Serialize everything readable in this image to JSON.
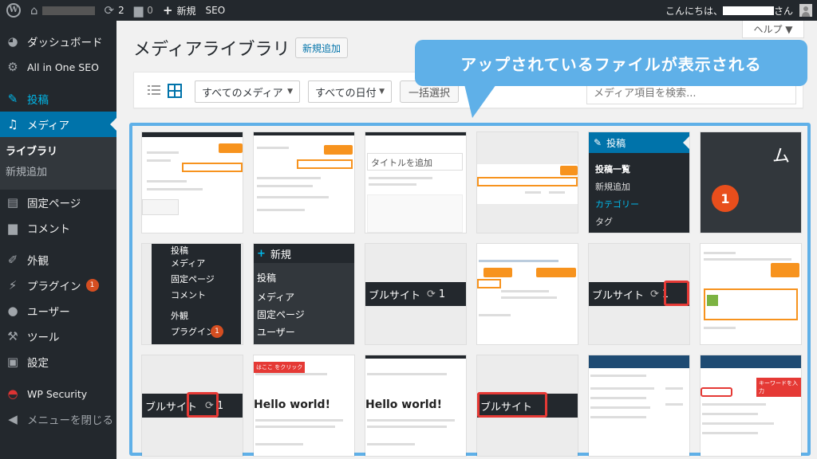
{
  "admin_bar": {
    "updates_count": "2",
    "comments_count": "0",
    "new_label": "新規",
    "seo_label": "SEO",
    "greeting_prefix": "こんにちは、",
    "greeting_suffix": "さん"
  },
  "sidebar": {
    "items": [
      {
        "label": "ダッシュボード",
        "icon": "dashboard-icon"
      },
      {
        "label": "All in One SEO",
        "icon": "gear-icon"
      },
      {
        "label": "投稿",
        "icon": "pin-icon"
      },
      {
        "label": "メディア",
        "icon": "media-icon"
      },
      {
        "label": "固定ページ",
        "icon": "page-icon"
      },
      {
        "label": "コメント",
        "icon": "comment-icon"
      },
      {
        "label": "外観",
        "icon": "brush-icon"
      },
      {
        "label": "プラグイン",
        "icon": "plugin-icon",
        "badge": "1"
      },
      {
        "label": "ユーザー",
        "icon": "user-icon"
      },
      {
        "label": "ツール",
        "icon": "wrench-icon"
      },
      {
        "label": "設定",
        "icon": "settings-icon"
      },
      {
        "label": "WP Security",
        "icon": "shield-icon"
      },
      {
        "label": "メニューを閉じる",
        "icon": "collapse-icon"
      }
    ],
    "submenu": [
      "ライブラリ",
      "新規追加"
    ]
  },
  "header": {
    "help_label": "ヘルプ ▼",
    "title": "メディアライブラリ",
    "add_new": "新規追加"
  },
  "toolbar": {
    "media_filter": "すべてのメディア",
    "date_filter": "すべての日付",
    "bulk_select": "一括選択",
    "search_placeholder": "メディア項目を検索..."
  },
  "callout": {
    "text": "アップされているファイルが表示される"
  },
  "tiles": {
    "t5": {
      "pin_label": "投稿",
      "items": [
        "投稿一覧",
        "新規追加",
        "カテゴリー",
        "タグ"
      ]
    },
    "t6": {
      "number": "1"
    },
    "t7": {
      "items": [
        "メディア",
        "固定ページ",
        "コメント",
        "外観",
        "プラグイン"
      ],
      "badge": "1",
      "top": "投稿"
    },
    "t8": {
      "new_label": "新規",
      "items": [
        "投稿",
        "メディア",
        "固定ページ",
        "ユーザー"
      ]
    },
    "t9": {
      "text": "ブルサイト",
      "count": "1"
    },
    "t11": {
      "text": "ブルサイト",
      "count": "1"
    },
    "t13": {
      "text": "ブルサイト",
      "count": "1"
    },
    "t14": {
      "tag": "はここ をクリック",
      "hello": "Hello world!"
    },
    "t15": {
      "hello": "Hello world!"
    },
    "t16": {
      "text": "ブルサイト"
    },
    "t18": {
      "tag": "キーワードを入力"
    },
    "t3": {
      "title": "タイトルを追加"
    }
  }
}
